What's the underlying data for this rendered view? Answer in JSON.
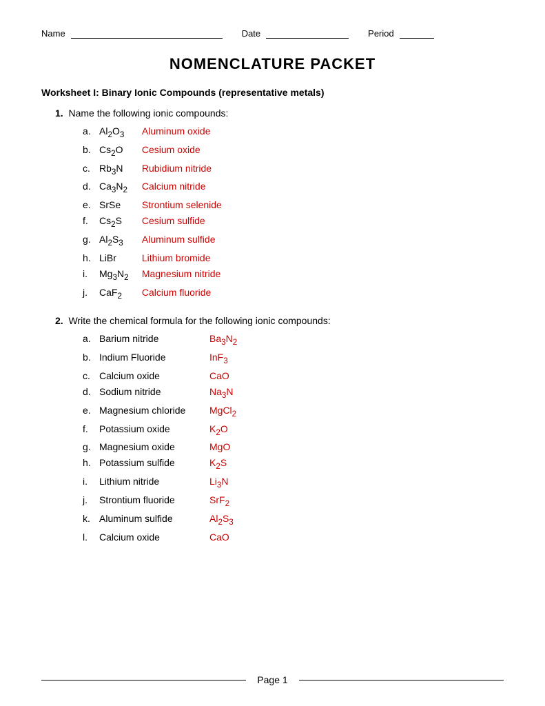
{
  "header": {
    "name_label": "Name",
    "date_label": "Date",
    "period_label": "Period"
  },
  "title": "Nomenclature Packet",
  "worksheet1": {
    "title": "Worksheet I: Binary Ionic Compounds (representative metals)",
    "q1_intro": "Name the following ionic compounds:",
    "q1_items": [
      {
        "label": "a.",
        "formula_html": "Al<sub>2</sub>O<sub>3</sub>",
        "answer": "Aluminum oxide"
      },
      {
        "label": "b.",
        "formula_html": "Cs<sub>2</sub>O",
        "answer": "Cesium oxide"
      },
      {
        "label": "c.",
        "formula_html": "Rb<sub>3</sub>N",
        "answer": "Rubidium nitride"
      },
      {
        "label": "d.",
        "formula_html": "Ca<sub>3</sub>N<sub>2</sub>",
        "answer": "Calcium nitride"
      },
      {
        "label": "e.",
        "formula_html": "SrSe",
        "answer": "Strontium selenide"
      },
      {
        "label": "f.",
        "formula_html": "Cs<sub>2</sub>S",
        "answer": "Cesium sulfide"
      },
      {
        "label": "g.",
        "formula_html": "Al<sub>2</sub>S<sub>3</sub>",
        "answer": "Aluminum sulfide"
      },
      {
        "label": "h.",
        "formula_html": "LiBr",
        "answer": "Lithium bromide"
      },
      {
        "label": "i.",
        "formula_html": "Mg<sub>3</sub>N<sub>2</sub>",
        "answer": "Magnesium nitride"
      },
      {
        "label": "j.",
        "formula_html": "CaF<sub>2</sub>",
        "answer": "Calcium fluoride"
      }
    ],
    "q2_intro": "Write the chemical formula for the following ionic compounds:",
    "q2_items": [
      {
        "label": "a.",
        "name": "Barium nitride",
        "answer_html": "Ba<sub>3</sub>N<sub>2</sub>"
      },
      {
        "label": "b.",
        "name": "Indium Fluoride",
        "answer_html": "InF<sub>3</sub>"
      },
      {
        "label": "c.",
        "name": "Calcium oxide",
        "answer_html": "CaO"
      },
      {
        "label": "d.",
        "name": "Sodium nitride",
        "answer_html": "Na<sub>3</sub>N"
      },
      {
        "label": "e.",
        "name": "Magnesium chloride",
        "answer_html": "MgCl<sub>2</sub>"
      },
      {
        "label": "f.",
        "name": "Potassium oxide",
        "answer_html": "K<sub>2</sub>O"
      },
      {
        "label": "g.",
        "name": "Magnesium oxide",
        "answer_html": "MgO"
      },
      {
        "label": "h.",
        "name": "Potassium sulfide",
        "answer_html": "K<sub>2</sub>S"
      },
      {
        "label": "i.",
        "name": "Lithium nitride",
        "answer_html": "Li<sub>3</sub>N"
      },
      {
        "label": "j.",
        "name": "Strontium fluoride",
        "answer_html": "SrF<sub>2</sub>"
      },
      {
        "label": "k.",
        "name": "Aluminum sulfide",
        "answer_html": "Al<sub>2</sub>S<sub>3</sub>"
      },
      {
        "label": "l.",
        "name": "Calcium oxide",
        "answer_html": "CaO"
      }
    ]
  },
  "footer": {
    "page_label": "Page 1"
  }
}
